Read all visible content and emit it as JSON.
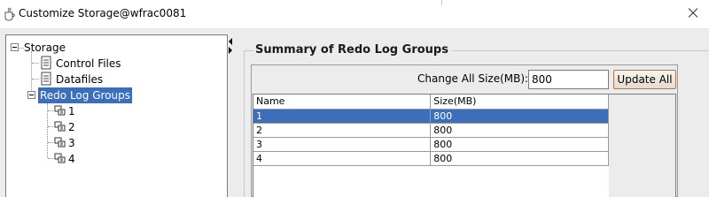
{
  "window": {
    "title": "Customize Storage@wfrac0081"
  },
  "tree": {
    "root": {
      "label": "Storage",
      "expanded": true
    },
    "items": [
      {
        "label": "Control Files",
        "icon": "document-icon"
      },
      {
        "label": "Datafiles",
        "icon": "document-icon"
      },
      {
        "label": "Redo Log Groups",
        "icon": "folder-icon",
        "expanded": true,
        "selected": true
      }
    ],
    "redo_groups": [
      {
        "label": "1",
        "icon": "redo-group-icon"
      },
      {
        "label": "2",
        "icon": "redo-group-icon"
      },
      {
        "label": "3",
        "icon": "redo-group-icon"
      },
      {
        "label": "4",
        "icon": "redo-group-icon"
      }
    ]
  },
  "summary": {
    "title": "Summary of Redo Log Groups",
    "change_all_label": "Change All Size(MB):",
    "change_all_value": "800",
    "update_all_label": "Update All"
  },
  "table": {
    "columns": [
      "Name",
      "Size(MB)"
    ],
    "rows": [
      {
        "name": "1",
        "size": "800",
        "selected": true
      },
      {
        "name": "2",
        "size": "800"
      },
      {
        "name": "3",
        "size": "800"
      },
      {
        "name": "4",
        "size": "800"
      }
    ]
  },
  "colors": {
    "selection": "#3d6eb9",
    "panel_bg": "#ececec"
  }
}
